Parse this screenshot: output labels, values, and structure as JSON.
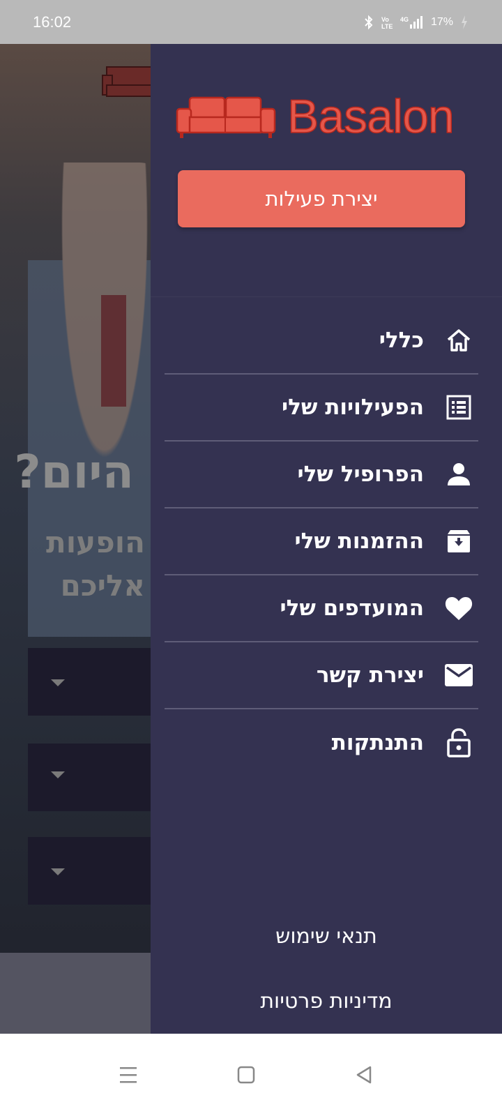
{
  "status_bar": {
    "time": "16:02",
    "battery": "17%",
    "icons": [
      "bluetooth-icon",
      "volte-icon",
      "signal-4g-icon",
      "battery-charging-icon"
    ]
  },
  "background_page": {
    "heading": "היום?",
    "subtitle_line1": "הופעות",
    "subtitle_line2": "אליכם",
    "dropdowns": [
      "",
      "",
      ""
    ]
  },
  "drawer": {
    "brand": "Basalon",
    "create_button": "יצירת פעילות",
    "menu": [
      {
        "label": "כללי",
        "icon": "home-icon"
      },
      {
        "label": "הפעילויות שלי",
        "icon": "list-icon"
      },
      {
        "label": "הפרופיל שלי",
        "icon": "person-icon"
      },
      {
        "label": "ההזמנות שלי",
        "icon": "archive-icon"
      },
      {
        "label": "המועדפים שלי",
        "icon": "heart-icon"
      },
      {
        "label": "יצירת קשר",
        "icon": "mail-icon"
      },
      {
        "label": "התנתקות",
        "icon": "lock-open-icon"
      }
    ],
    "terms": "תנאי שימוש",
    "privacy": "מדיניות פרטיות"
  },
  "colors": {
    "drawer_bg": "#343251",
    "accent": "#ea6b5e",
    "brand_red": "#e5574a"
  },
  "nav_bar": {
    "buttons": [
      "menu-icon",
      "home-square-icon",
      "back-icon"
    ]
  }
}
